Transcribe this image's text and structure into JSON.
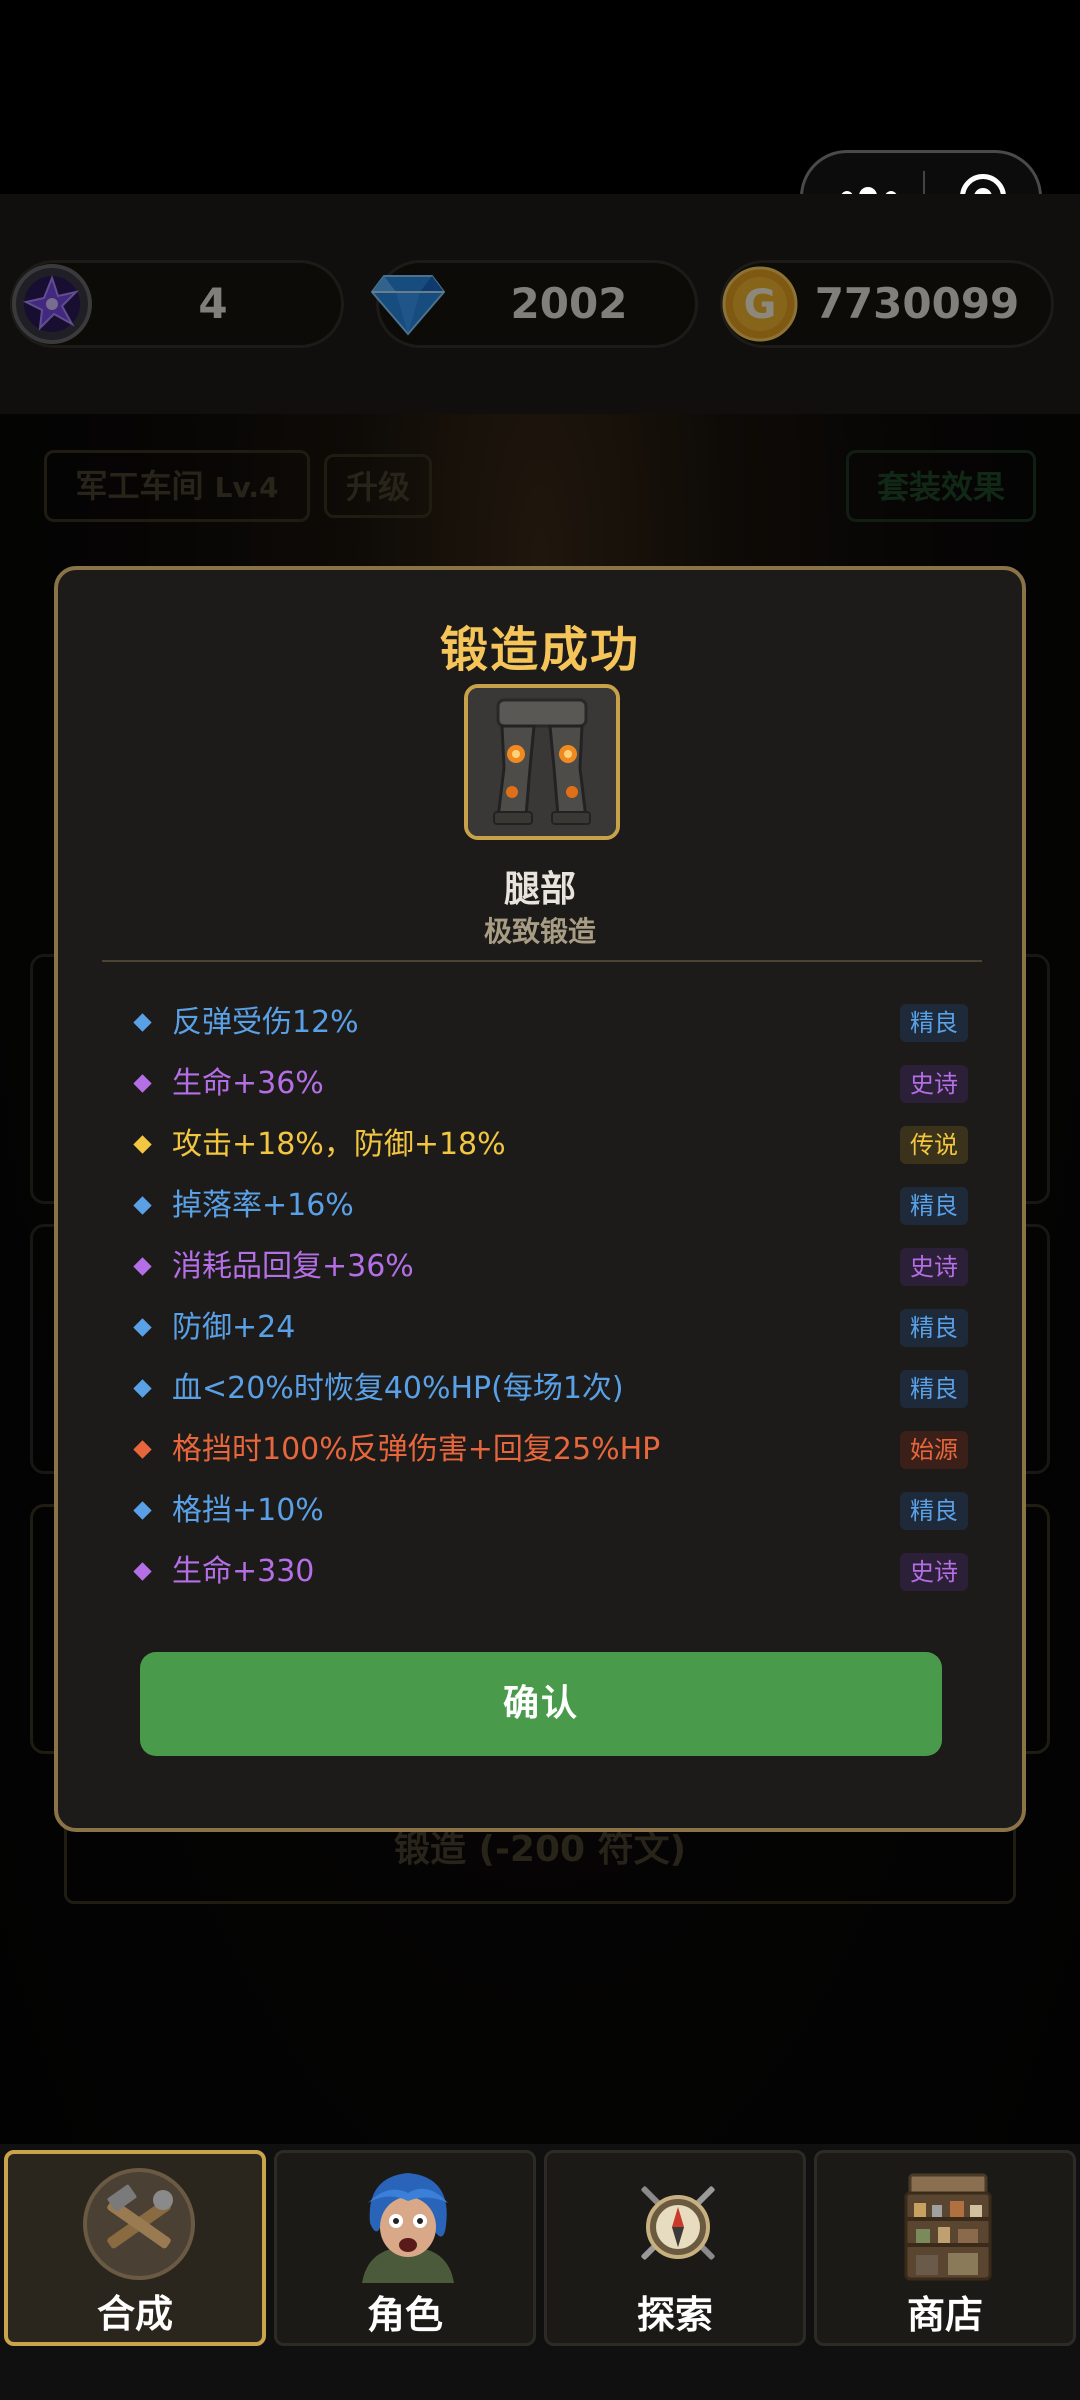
{
  "resources": {
    "rune": {
      "icon": "purple-rune-gem-icon",
      "value": "4"
    },
    "diamond": {
      "icon": "blue-diamond-icon",
      "value": "2002"
    },
    "gold": {
      "icon": "gold-coin-icon",
      "value": "7730099",
      "coin_letter": "G"
    }
  },
  "background": {
    "workshop_label": "军工车间",
    "workshop_level": "Lv.4",
    "upgrade_label": "升级",
    "set_bonus_label": "套装效果",
    "forge_button_label": "锻造 (-200 符文)"
  },
  "modal": {
    "title": "锻造成功",
    "item_icon": "armored-legs-icon",
    "item_name": "腿部",
    "item_quality": "极致锻造",
    "stats": [
      {
        "text": "反弹受伤12%",
        "rarity": "精良",
        "color": "#5aa0e6",
        "badge_bg": "#1e2a3a"
      },
      {
        "text": "生命+36%",
        "rarity": "史诗",
        "color": "#b46ee6",
        "badge_bg": "#2c2038"
      },
      {
        "text": "攻击+18%，防御+18%",
        "rarity": "传说",
        "color": "#f2c640",
        "badge_bg": "#3a321a"
      },
      {
        "text": "掉落率+16%",
        "rarity": "精良",
        "color": "#5aa0e6",
        "badge_bg": "#1e2a3a"
      },
      {
        "text": "消耗品回复+36%",
        "rarity": "史诗",
        "color": "#b46ee6",
        "badge_bg": "#2c2038"
      },
      {
        "text": "防御+24",
        "rarity": "精良",
        "color": "#5aa0e6",
        "badge_bg": "#1e2a3a"
      },
      {
        "text": "血<20%时恢复40%HP(每场1次)",
        "rarity": "精良",
        "color": "#5aa0e6",
        "badge_bg": "#1e2a3a"
      },
      {
        "text": "格挡时100%反弹伤害+回复25%HP",
        "rarity": "始源",
        "color": "#e8663c",
        "badge_bg": "#3a2018"
      },
      {
        "text": "格挡+10%",
        "rarity": "精良",
        "color": "#5aa0e6",
        "badge_bg": "#1e2a3a"
      },
      {
        "text": "生命+330",
        "rarity": "史诗",
        "color": "#b46ee6",
        "badge_bg": "#2c2038"
      }
    ],
    "confirm_label": "确认"
  },
  "nav": {
    "tabs": [
      {
        "label": "合成",
        "icon": "crafting-tools-icon",
        "active": true
      },
      {
        "label": "角色",
        "icon": "character-portrait-icon",
        "active": false
      },
      {
        "label": "探索",
        "icon": "compass-swords-icon",
        "active": false
      },
      {
        "label": "商店",
        "icon": "shop-shelf-icon",
        "active": false
      }
    ]
  }
}
